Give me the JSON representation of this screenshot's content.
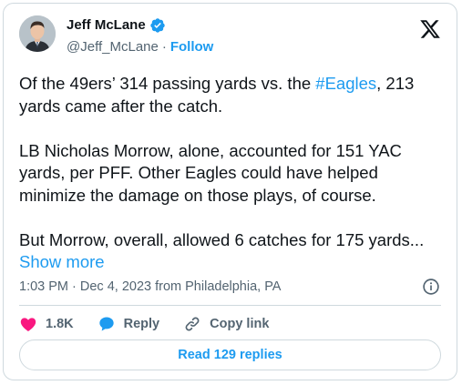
{
  "author": {
    "name": "Jeff McLane",
    "handle": "@Jeff_McLane",
    "separator": "·",
    "follow_label": "Follow",
    "verified_color": "#1d9bf0"
  },
  "tweet": {
    "line1_before": "Of the 49ers’ 314 passing yards vs. the ",
    "hashtag": "#Eagles",
    "line1_after": ", 213 yards came after the catch.",
    "paragraph2": "LB Nicholas Morrow, alone, accounted for 151 YAC yards, per PFF. Other Eagles could have helped minimize the damage on those plays, of course.",
    "paragraph3": "But Morrow, overall, allowed 6 catches for 175 yards...",
    "show_more": "Show more"
  },
  "meta": {
    "timestamp": "1:03 PM · Dec 4, 2023 from Philadelphia, PA"
  },
  "actions": {
    "likes": "1.8K",
    "reply_label": "Reply",
    "copy_link_label": "Copy link"
  },
  "replies_button": {
    "label": "Read 129 replies"
  },
  "icons": {
    "brand": "x-logo-icon",
    "verified": "verified-badge-icon",
    "info": "info-icon",
    "like": "heart-icon",
    "reply": "speech-bubble-icon",
    "link": "link-icon"
  },
  "colors": {
    "accent": "#1d9bf0",
    "like": "#f91880",
    "text": "#0f1419",
    "muted": "#536471",
    "border": "#cfd9de"
  }
}
